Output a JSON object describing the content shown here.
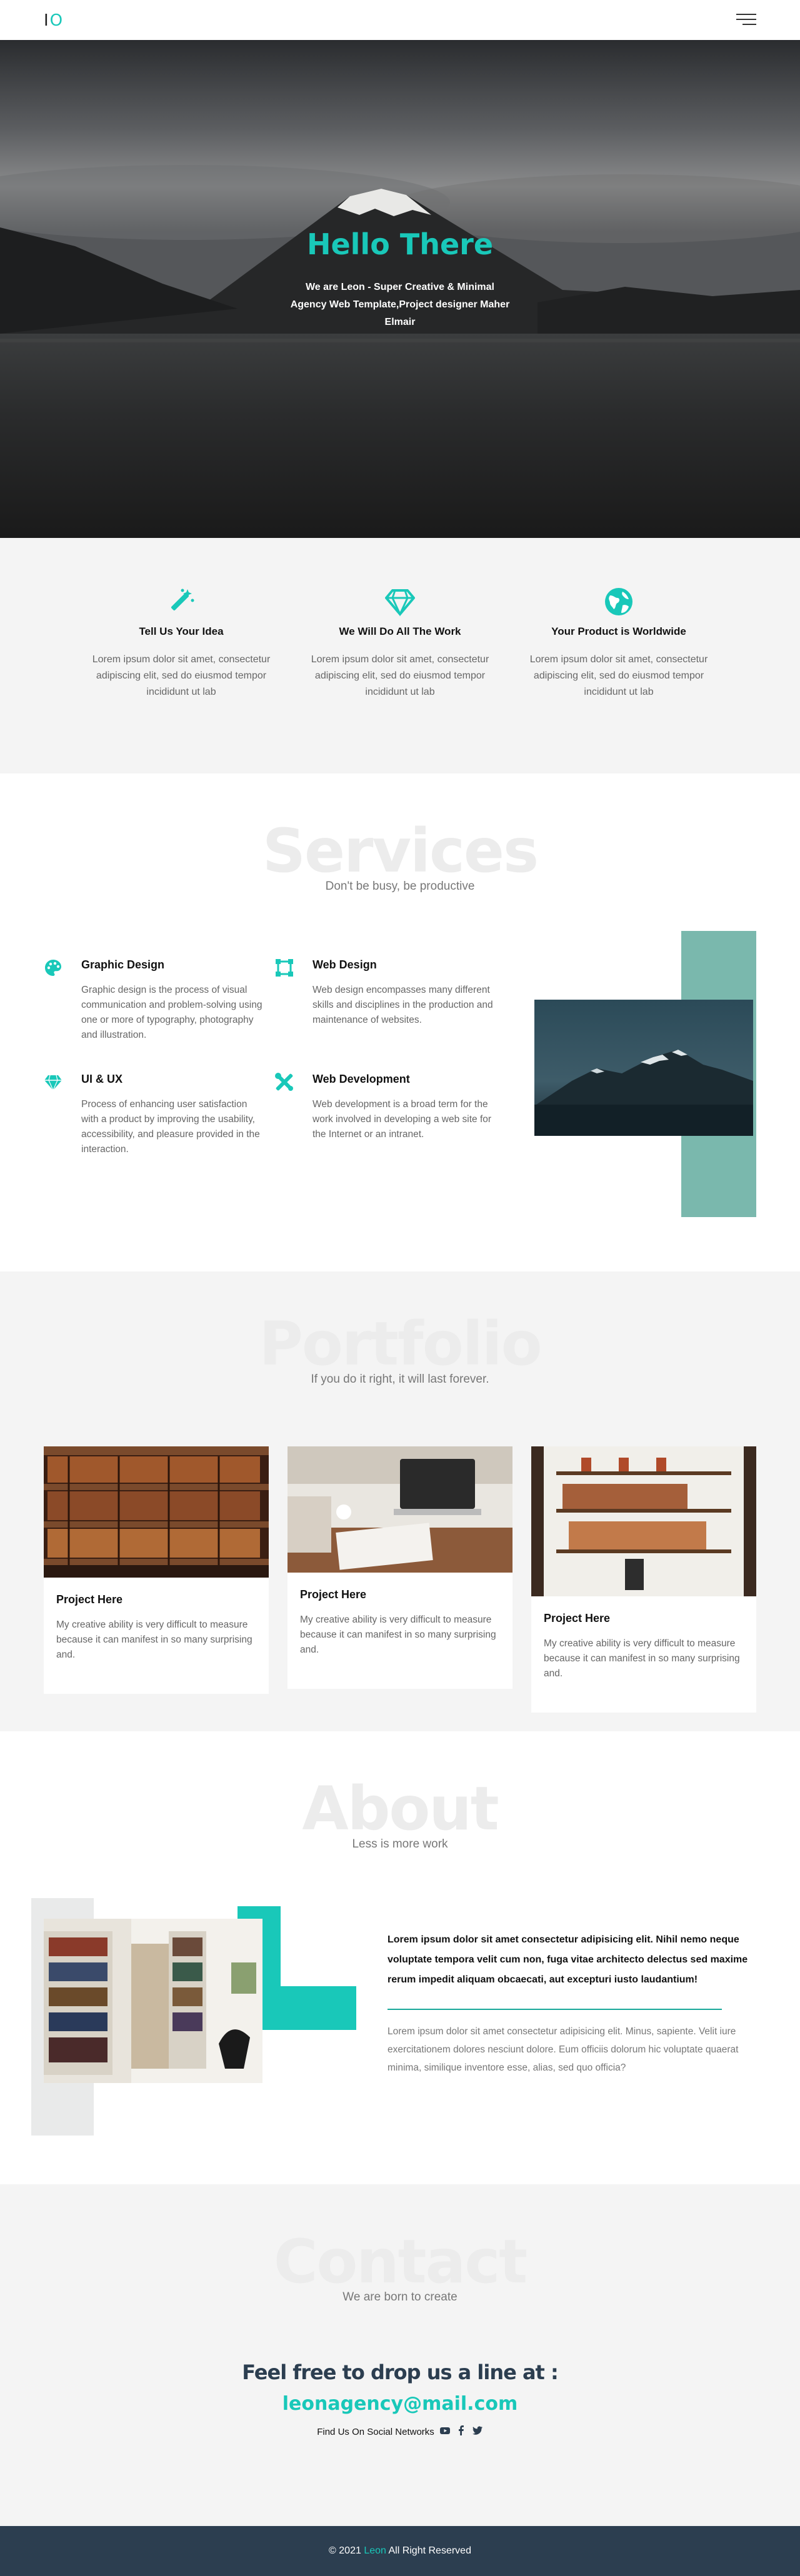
{
  "nav": {
    "logo_i": "I",
    "logo_o": "O"
  },
  "hero": {
    "title": "Hello There",
    "subtitle": "We are Leon - Super Creative & Minimal Agency Web Template,Project designer Maher Elmair"
  },
  "features": [
    {
      "icon": "magic-wand-icon",
      "title": "Tell Us Your Idea",
      "text": "Lorem ipsum dolor sit amet, consectetur adipiscing elit, sed do eiusmod tempor incididunt ut lab"
    },
    {
      "icon": "diamond-icon",
      "title": "We Will Do All The Work",
      "text": "Lorem ipsum dolor sit amet, consectetur adipiscing elit, sed do eiusmod tempor incididunt ut lab"
    },
    {
      "icon": "globe-icon",
      "title": "Your Product is Worldwide",
      "text": "Lorem ipsum dolor sit amet, consectetur adipiscing elit, sed do eiusmod tempor incididunt ut lab"
    }
  ],
  "services": {
    "heading": "Services",
    "subheading": "Don't be busy, be productive",
    "items": [
      {
        "icon": "palette-icon",
        "title": "Graphic Design",
        "text": "Graphic design is the process of visual communication and problem-solving using one or more of typography, photography and illustration."
      },
      {
        "icon": "vector-square-icon",
        "title": "Web Design",
        "text": "Web design encompasses many different skills and disciplines in the production and maintenance of websites."
      },
      {
        "icon": "gem-icon",
        "title": "UI & UX",
        "text": "Process of enhancing user satisfaction with a product by improving the usability, accessibility, and pleasure provided in the interaction."
      },
      {
        "icon": "tools-icon",
        "title": "Web Development",
        "text": "Web development is a broad term for the work involved in developing a web site for the Internet or an intranet."
      }
    ]
  },
  "portfolio": {
    "heading": "Portfolio",
    "subheading": "If you do it right, it will last forever.",
    "cards": [
      {
        "title": "Project Here",
        "text": "My creative ability is very difficult to measure because it can manifest in so many surprising and."
      },
      {
        "title": "Project Here",
        "text": "My creative ability is very difficult to measure because it can manifest in so many surprising and."
      },
      {
        "title": "Project Here",
        "text": "My creative ability is very difficult to measure because it can manifest in so many surprising and."
      }
    ]
  },
  "about": {
    "heading": "About",
    "subheading": "Less is more work",
    "bold_text": "Lorem ipsum dolor sit amet consectetur adipisicing elit. Nihil nemo neque voluptate tempora velit cum non, fuga vitae architecto delectus sed maxime rerum impedit aliquam obcaecati, aut excepturi iusto laudantium!",
    "light_text": "Lorem ipsum dolor sit amet consectetur adipisicing elit. Minus, sapiente. Velit iure exercitationem dolores nesciunt dolore. Eum officiis dolorum hic voluptate quaerat minima, similique inventore esse, alias, sed quo officia?"
  },
  "contact": {
    "heading": "Contact",
    "subheading": "We are born to create",
    "line": "Feel free to drop us a line at :",
    "email": "leonagency@mail.com",
    "social_label": "Find Us On Social Networks",
    "social_icons": [
      "youtube-icon",
      "facebook-icon",
      "twitter-icon"
    ]
  },
  "footer": {
    "prefix": "© 2021",
    "brand": "Leon",
    "suffix": "All Right Reserved"
  },
  "colors": {
    "accent": "#19c8b9",
    "dark": "#2c3e50",
    "teal_muted": "#7ab8ad"
  }
}
